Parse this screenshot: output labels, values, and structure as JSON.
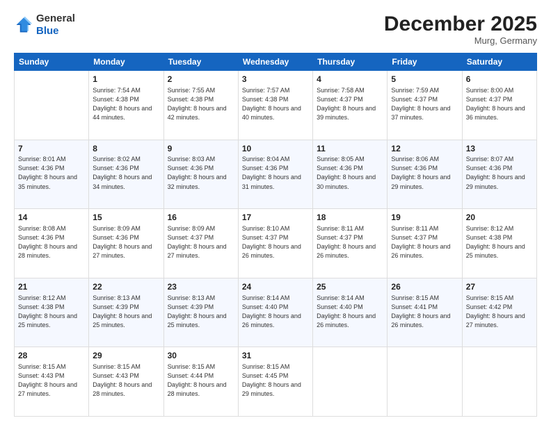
{
  "header": {
    "logo": {
      "general": "General",
      "blue": "Blue"
    },
    "title": "December 2025",
    "location": "Murg, Germany"
  },
  "days_of_week": [
    "Sunday",
    "Monday",
    "Tuesday",
    "Wednesday",
    "Thursday",
    "Friday",
    "Saturday"
  ],
  "weeks": [
    [
      {
        "day": "",
        "sunrise": "",
        "sunset": "",
        "daylight": "",
        "empty": true
      },
      {
        "day": "1",
        "sunrise": "7:54 AM",
        "sunset": "4:38 PM",
        "daylight": "8 hours and 44 minutes."
      },
      {
        "day": "2",
        "sunrise": "7:55 AM",
        "sunset": "4:38 PM",
        "daylight": "8 hours and 42 minutes."
      },
      {
        "day": "3",
        "sunrise": "7:57 AM",
        "sunset": "4:38 PM",
        "daylight": "8 hours and 40 minutes."
      },
      {
        "day": "4",
        "sunrise": "7:58 AM",
        "sunset": "4:37 PM",
        "daylight": "8 hours and 39 minutes."
      },
      {
        "day": "5",
        "sunrise": "7:59 AM",
        "sunset": "4:37 PM",
        "daylight": "8 hours and 37 minutes."
      },
      {
        "day": "6",
        "sunrise": "8:00 AM",
        "sunset": "4:37 PM",
        "daylight": "8 hours and 36 minutes."
      }
    ],
    [
      {
        "day": "7",
        "sunrise": "8:01 AM",
        "sunset": "4:36 PM",
        "daylight": "8 hours and 35 minutes."
      },
      {
        "day": "8",
        "sunrise": "8:02 AM",
        "sunset": "4:36 PM",
        "daylight": "8 hours and 34 minutes."
      },
      {
        "day": "9",
        "sunrise": "8:03 AM",
        "sunset": "4:36 PM",
        "daylight": "8 hours and 32 minutes."
      },
      {
        "day": "10",
        "sunrise": "8:04 AM",
        "sunset": "4:36 PM",
        "daylight": "8 hours and 31 minutes."
      },
      {
        "day": "11",
        "sunrise": "8:05 AM",
        "sunset": "4:36 PM",
        "daylight": "8 hours and 30 minutes."
      },
      {
        "day": "12",
        "sunrise": "8:06 AM",
        "sunset": "4:36 PM",
        "daylight": "8 hours and 29 minutes."
      },
      {
        "day": "13",
        "sunrise": "8:07 AM",
        "sunset": "4:36 PM",
        "daylight": "8 hours and 29 minutes."
      }
    ],
    [
      {
        "day": "14",
        "sunrise": "8:08 AM",
        "sunset": "4:36 PM",
        "daylight": "8 hours and 28 minutes."
      },
      {
        "day": "15",
        "sunrise": "8:09 AM",
        "sunset": "4:36 PM",
        "daylight": "8 hours and 27 minutes."
      },
      {
        "day": "16",
        "sunrise": "8:09 AM",
        "sunset": "4:37 PM",
        "daylight": "8 hours and 27 minutes."
      },
      {
        "day": "17",
        "sunrise": "8:10 AM",
        "sunset": "4:37 PM",
        "daylight": "8 hours and 26 minutes."
      },
      {
        "day": "18",
        "sunrise": "8:11 AM",
        "sunset": "4:37 PM",
        "daylight": "8 hours and 26 minutes."
      },
      {
        "day": "19",
        "sunrise": "8:11 AM",
        "sunset": "4:37 PM",
        "daylight": "8 hours and 26 minutes."
      },
      {
        "day": "20",
        "sunrise": "8:12 AM",
        "sunset": "4:38 PM",
        "daylight": "8 hours and 25 minutes."
      }
    ],
    [
      {
        "day": "21",
        "sunrise": "8:12 AM",
        "sunset": "4:38 PM",
        "daylight": "8 hours and 25 minutes."
      },
      {
        "day": "22",
        "sunrise": "8:13 AM",
        "sunset": "4:39 PM",
        "daylight": "8 hours and 25 minutes."
      },
      {
        "day": "23",
        "sunrise": "8:13 AM",
        "sunset": "4:39 PM",
        "daylight": "8 hours and 25 minutes."
      },
      {
        "day": "24",
        "sunrise": "8:14 AM",
        "sunset": "4:40 PM",
        "daylight": "8 hours and 26 minutes."
      },
      {
        "day": "25",
        "sunrise": "8:14 AM",
        "sunset": "4:40 PM",
        "daylight": "8 hours and 26 minutes."
      },
      {
        "day": "26",
        "sunrise": "8:15 AM",
        "sunset": "4:41 PM",
        "daylight": "8 hours and 26 minutes."
      },
      {
        "day": "27",
        "sunrise": "8:15 AM",
        "sunset": "4:42 PM",
        "daylight": "8 hours and 27 minutes."
      }
    ],
    [
      {
        "day": "28",
        "sunrise": "8:15 AM",
        "sunset": "4:43 PM",
        "daylight": "8 hours and 27 minutes."
      },
      {
        "day": "29",
        "sunrise": "8:15 AM",
        "sunset": "4:43 PM",
        "daylight": "8 hours and 28 minutes."
      },
      {
        "day": "30",
        "sunrise": "8:15 AM",
        "sunset": "4:44 PM",
        "daylight": "8 hours and 28 minutes."
      },
      {
        "day": "31",
        "sunrise": "8:15 AM",
        "sunset": "4:45 PM",
        "daylight": "8 hours and 29 minutes."
      },
      {
        "day": "",
        "sunrise": "",
        "sunset": "",
        "daylight": "",
        "empty": true
      },
      {
        "day": "",
        "sunrise": "",
        "sunset": "",
        "daylight": "",
        "empty": true
      },
      {
        "day": "",
        "sunrise": "",
        "sunset": "",
        "daylight": "",
        "empty": true
      }
    ]
  ],
  "labels": {
    "sunrise": "Sunrise:",
    "sunset": "Sunset:",
    "daylight": "Daylight:"
  }
}
